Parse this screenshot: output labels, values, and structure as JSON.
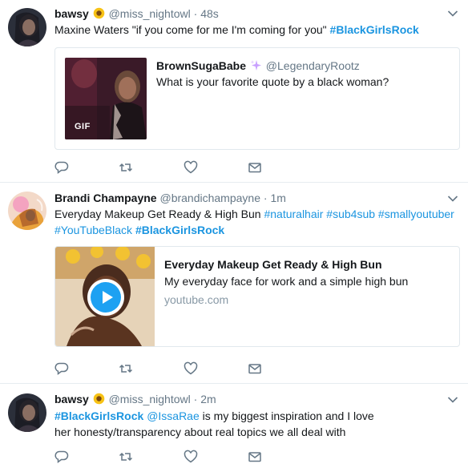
{
  "tweets": [
    {
      "name": "bawsy",
      "emoji": "sunflower",
      "handle": "@miss_nightowl",
      "separator": "·",
      "time": "48s",
      "text_plain": "Maxine Waters \"if you come for me I'm coming for you\" ",
      "hashtag": "#BlackGirlsRock",
      "quote": {
        "name": "BrownSugaBabe",
        "emoji": "sparkles",
        "handle": "@LegendaryRootz",
        "text": "What is your favorite quote by a black woman?",
        "media_badge": "GIF"
      }
    },
    {
      "name": "Brandi Champayne",
      "handle": "@brandichampayne",
      "separator": "·",
      "time": "1m",
      "text_line1_plain": "Everyday Makeup Get Ready & High Bun ",
      "tag_naturalhair": "#naturalhair",
      "tag_sub4sub": "#sub4sub",
      "tag_smallyoutuber": "#smallyoutuber",
      "tag_youtubeblack": "#YouTubeBlack",
      "tag_blackgirlsrock": "#BlackGirlsRock",
      "card": {
        "title": "Everyday Makeup Get Ready & High Bun",
        "description": "My everyday face for work and a simple high bun",
        "domain": "youtube.com"
      }
    },
    {
      "name": "bawsy",
      "emoji": "sunflower",
      "handle": "@miss_nightowl",
      "separator": "·",
      "time": "2m",
      "hashtag": "#BlackGirlsRock",
      "mention": "@IssaRae",
      "text_rest": " is my biggest inspiration and I love her honesty/transparency about real topics we all deal with"
    }
  ],
  "actions": [
    "reply-icon",
    "retweet-icon",
    "like-icon",
    "direct-message-icon"
  ],
  "colors": {
    "link": "#1b95e0",
    "muted": "#657786",
    "icon": "#657786",
    "border": "#e6ecf0"
  }
}
